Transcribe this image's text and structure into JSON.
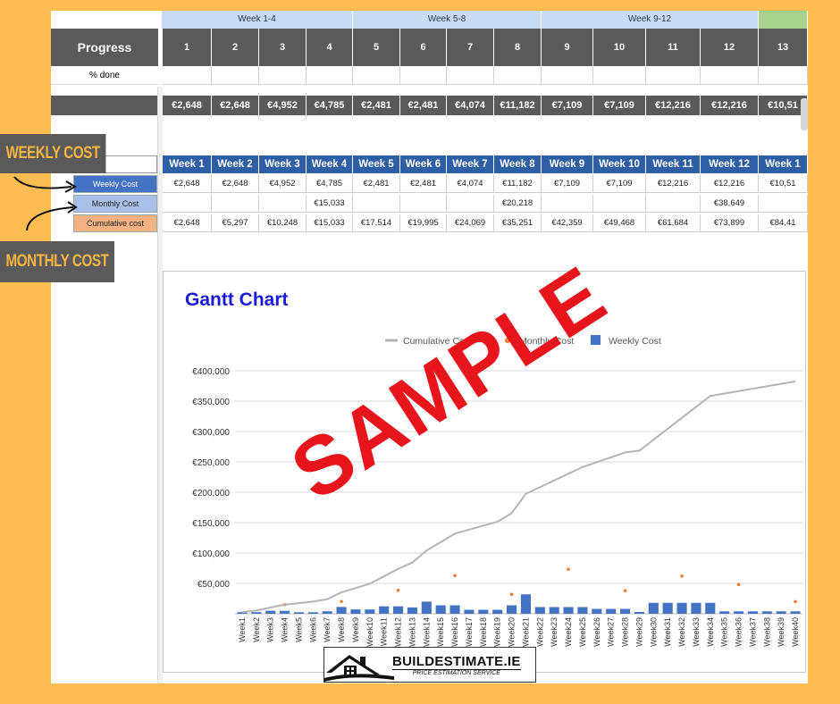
{
  "groups": [
    {
      "label": "Week 1-4"
    },
    {
      "label": "Week 5-8"
    },
    {
      "label": "Week 9-12"
    },
    {
      "label": ""
    }
  ],
  "progress": {
    "title": "Progress",
    "pct_label": "% done",
    "weeks": [
      "1",
      "2",
      "3",
      "4",
      "5",
      "6",
      "7",
      "8",
      "9",
      "10",
      "11",
      "12",
      "13"
    ]
  },
  "cost_row": [
    "€2,648",
    "€2,648",
    "€4,952",
    "€4,785",
    "€2,481",
    "€2,481",
    "€4,074",
    "€11,182",
    "€7,109",
    "€7,109",
    "€12,216",
    "€12,216",
    "€10,51"
  ],
  "week_headers": [
    "Week 1",
    "Week 2",
    "Week 3",
    "Week 4",
    "Week 5",
    "Week 6",
    "Week 7",
    "Week 8",
    "Week 9",
    "Week 10",
    "Week 11",
    "Week 12",
    "Week 1"
  ],
  "rows": {
    "weekly": {
      "label": "Weekly Cost",
      "values": [
        "€2,648",
        "€2,648",
        "€4,952",
        "€4,785",
        "€2,481",
        "€2,481",
        "€4,074",
        "€11,182",
        "€7,109",
        "€7,109",
        "€12,216",
        "€12,216",
        "€10,51"
      ]
    },
    "monthly": {
      "label": "Monthly Cost",
      "values": [
        "",
        "",
        "",
        "€15,033",
        "",
        "",
        "",
        "€20,218",
        "",
        "",
        "",
        "€38,649",
        ""
      ]
    },
    "cumulative": {
      "label": "Cumulative cost",
      "values": [
        "€2,648",
        "€5,297",
        "€10,248",
        "€15,033",
        "€17,514",
        "€19,995",
        "€24,069",
        "€35,251",
        "€42,359",
        "€49,468",
        "€61,684",
        "€73,899",
        "€84,41"
      ]
    }
  },
  "callouts": {
    "weekly": "WEEKLY COST",
    "monthly": "MONTHLY COST"
  },
  "stamp": "SAMPLE",
  "logo": {
    "name": "BUILDESTIMATE.IE",
    "tagline": "PRICE ESTIMATION SERVICE"
  },
  "colors": {
    "accent": "#fbbd52",
    "header": "#5a5a5a",
    "week_blue": "#2e5ea3",
    "bar": "#4472c4",
    "line": "#b4b4b4",
    "monthly": "#ed7d31",
    "stamp": "#e8141c"
  },
  "chart_data": {
    "type": "bar",
    "title": "Gantt Chart",
    "legend": [
      "Cumulative Cost",
      "Monthly Cost",
      "Weekly Cost"
    ],
    "legend_position": "top",
    "grid": true,
    "ylim": [
      0,
      400000
    ],
    "yticks": [
      "€50,000",
      "€100,000",
      "€150,000",
      "€200,000",
      "€250,000",
      "€300,000",
      "€350,000",
      "€400,000"
    ],
    "categories": [
      "Week1",
      "Week2",
      "Week3",
      "Week4",
      "Week5",
      "Week6",
      "Week7",
      "Week8",
      "Week9",
      "Week10",
      "Week11",
      "Week12",
      "Week13",
      "Week14",
      "Week15",
      "Week16",
      "Week17",
      "Week18",
      "Week19",
      "Week20",
      "Week21",
      "Week22",
      "Week23",
      "Week24",
      "Week25",
      "Week26",
      "Week27",
      "Week28",
      "Week29",
      "Week30",
      "Week31",
      "Week32",
      "Week33",
      "Week34",
      "Week35",
      "Week36",
      "Week37",
      "Week38",
      "Week39",
      "Week40"
    ],
    "series": [
      {
        "name": "Weekly Cost",
        "values": [
          2648,
          2648,
          4952,
          4785,
          2481,
          2481,
          4074,
          11182,
          7109,
          7109,
          12216,
          12216,
          10510,
          20000,
          14000,
          14000,
          6500,
          6500,
          6500,
          14000,
          32000,
          11000,
          11000,
          11000,
          11000,
          8000,
          8000,
          8000,
          3000,
          18000,
          18000,
          18000,
          18000,
          18000,
          4000,
          4000,
          4000,
          4000,
          4000,
          4000
        ]
      },
      {
        "name": "Monthly Cost",
        "values": [
          null,
          null,
          null,
          15033,
          null,
          null,
          null,
          20218,
          null,
          null,
          null,
          38649,
          null,
          null,
          null,
          63000,
          null,
          null,
          null,
          32000,
          null,
          null,
          null,
          73000,
          null,
          null,
          null,
          38000,
          null,
          null,
          null,
          62000,
          null,
          null,
          null,
          48000,
          null,
          null,
          null,
          20000
        ]
      },
      {
        "name": "Cumulative Cost",
        "values": [
          2648,
          5297,
          10248,
          15033,
          17514,
          19995,
          24069,
          35251,
          42359,
          49468,
          61684,
          73899,
          84410,
          104000,
          118000,
          132000,
          138500,
          145000,
          151500,
          165500,
          197500,
          208500,
          219500,
          230500,
          241500,
          249500,
          257500,
          265500,
          268500,
          286500,
          304500,
          322500,
          340500,
          358500,
          362500,
          366500,
          370500,
          374500,
          378500,
          382500
        ]
      }
    ]
  }
}
